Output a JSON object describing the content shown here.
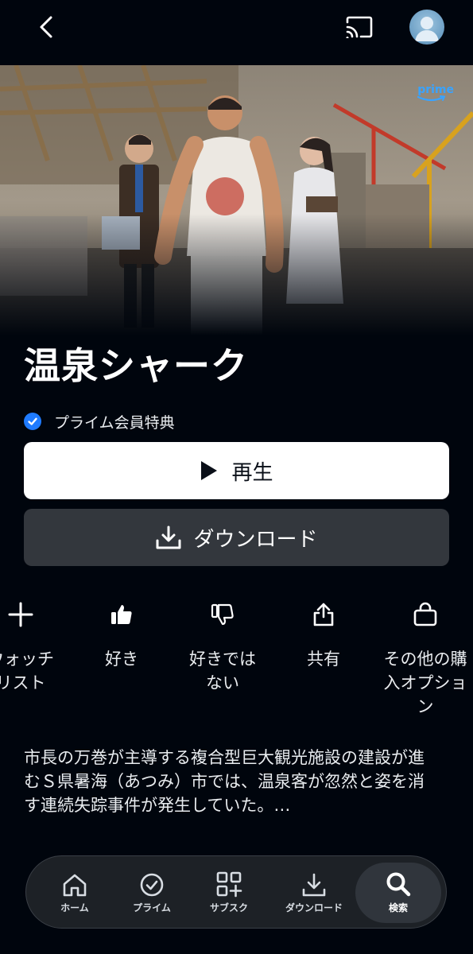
{
  "header": {
    "back_icon": "chevron-left-icon",
    "cast_icon": "cast-icon",
    "avatar_icon": "user-avatar"
  },
  "hero": {
    "logo_text": "prime"
  },
  "title": "温泉シャーク",
  "badge": {
    "icon": "check-circle-icon",
    "text": "プライム会員特典",
    "color": "#1f7bff"
  },
  "buttons": {
    "play_label": "再生",
    "download_label": "ダウンロード"
  },
  "actions": [
    {
      "icon": "plus-icon",
      "label": "ウォッチ\nリスト"
    },
    {
      "icon": "thumbs-up-icon",
      "label": "好き"
    },
    {
      "icon": "thumbs-down-icon",
      "label": "好きでは\nない"
    },
    {
      "icon": "share-icon",
      "label": "共有"
    },
    {
      "icon": "shopping-bag-icon",
      "label": "その他の購\n入オプショ\nン"
    }
  ],
  "synopsis": "市長の万巻が主導する複合型巨大観光施設の建設が進むＳ県暑海（あつみ）市では、温泉客が忽然と姿を消す連続失踪事件が発生していた。…",
  "nav": {
    "items": [
      {
        "icon": "home-icon",
        "label": "ホーム"
      },
      {
        "icon": "prime-check-icon",
        "label": "プライム"
      },
      {
        "icon": "grid-plus-icon",
        "label": "サブスク"
      },
      {
        "icon": "download-icon",
        "label": "ダウンロード"
      },
      {
        "icon": "search-icon",
        "label": "検索",
        "active": true
      }
    ]
  },
  "colors": {
    "background": "#00050d",
    "accent": "#1f7bff",
    "prime_blue": "#3aa3ff"
  }
}
